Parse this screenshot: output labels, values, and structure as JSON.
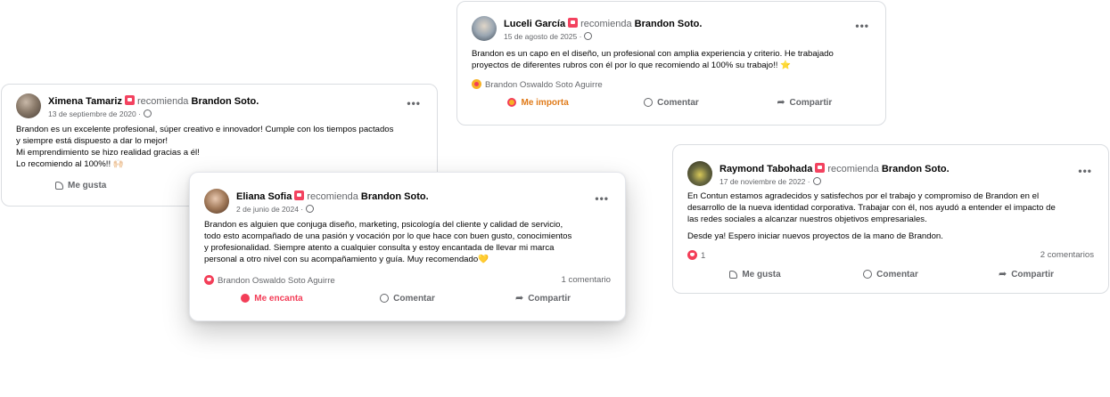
{
  "common": {
    "recommends": "recomienda",
    "page": "Brandon Soto.",
    "more": "•••",
    "comment": "Comentar",
    "share": "Compartir",
    "like": "Me gusta",
    "reactor": "Brandon Oswaldo Soto Aguirre"
  },
  "colors": {
    "love": "#f33e58",
    "care": "#f7b125",
    "muted": "#65676b",
    "recommend": "#f3425f"
  },
  "posts": {
    "ximena": {
      "name": "Ximena Tamariz",
      "date": "13 de septiembre de 2020 ·",
      "lines": [
        "Brandon es un excelente profesional, súper creativo e innovador! Cumple con los tiempos pactados",
        "y siempre está dispuesto a dar lo mejor!",
        "Mi emprendimiento se hizo realidad gracias a él!",
        "Lo recomiendo al 100%!! 🙌🏻"
      ],
      "action": "Me gusta"
    },
    "luceli": {
      "name": "Luceli García",
      "date": "15 de agosto de 2025 ·",
      "lines": [
        "Brandon es un capo en el diseño, un profesional con amplia experiencia y criterio. He trabajado",
        "proyectos de diferentes rubros con él por lo que recomiendo al 100% su trabajo!! ⭐"
      ],
      "reactor": "Brandon Oswaldo Soto Aguirre",
      "action": "Me importa"
    },
    "eliana": {
      "name": "Eliana Sofia",
      "date": "2 de junio de 2024 ·",
      "lines": [
        "Brandon es alguien que conjuga diseño, marketing, psicología del cliente y calidad de servicio,",
        "todo esto acompañado de una pasión y vocación por lo que hace con buen gusto, conocimientos",
        "y profesionalidad. Siempre atento a cualquier consulta y estoy encantada de llevar mi marca",
        "personal a otro nivel con su acompañamiento y guía. Muy recomendado💛"
      ],
      "reactor": "Brandon Oswaldo Soto Aguirre",
      "comments": "1 comentario",
      "action": "Me encanta"
    },
    "raymond": {
      "name": "Raymond Tabohada",
      "date": "17 de noviembre de 2022 ·",
      "lines": [
        "En Contun estamos agradecidos y satisfechos por el trabajo y compromiso de Brandon en el",
        "desarrollo de la nueva identidad corporativa. Trabajar con él, nos ayudó a entender el impacto de",
        "las redes sociales a alcanzar nuestros objetivos empresariales."
      ],
      "line2": "Desde ya! Espero iniciar nuevos proyectos de la mano de Brandon.",
      "reactions": "1",
      "comments": "2 comentarios",
      "action": "Me gusta"
    }
  }
}
